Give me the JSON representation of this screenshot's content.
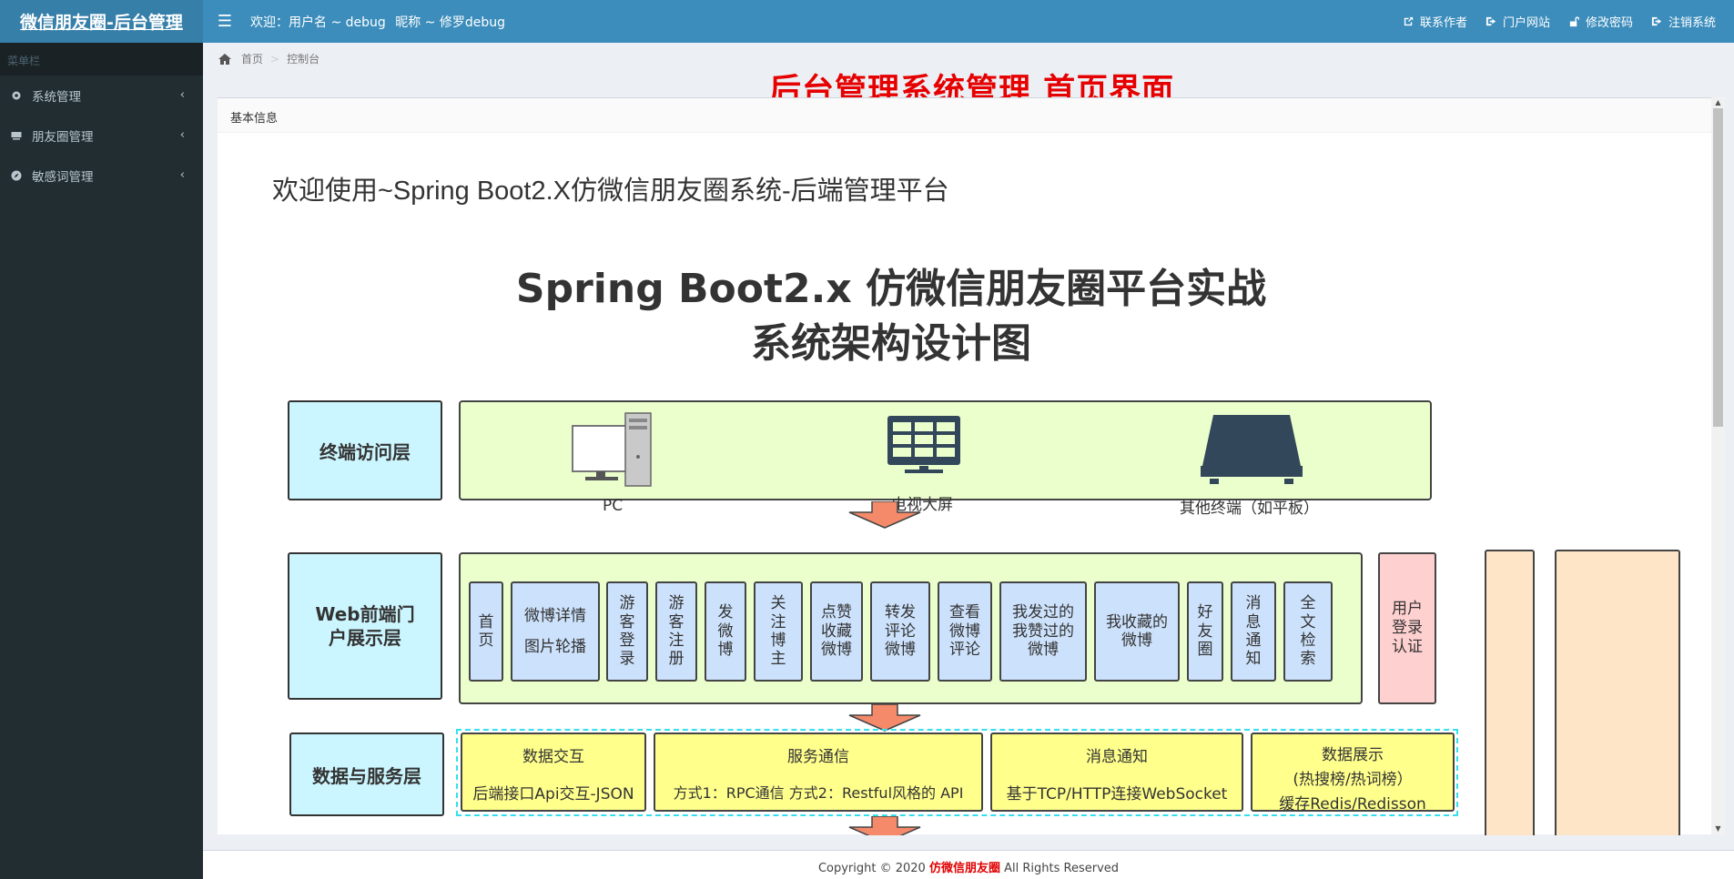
{
  "header": {
    "brand": "微信朋友圈-后台管理",
    "welcome_prefix": "欢迎：用户名 ~ debug",
    "welcome_nick": "昵称 ~ 修罗debug",
    "links": [
      {
        "label": "联系作者",
        "icon": "external-link-icon"
      },
      {
        "label": "门户网站",
        "icon": "sign-out-icon"
      },
      {
        "label": "修改密码",
        "icon": "unlock-icon"
      },
      {
        "label": "注销系统",
        "icon": "sign-out-icon"
      }
    ]
  },
  "sidebar": {
    "header": "菜单栏",
    "items": [
      {
        "label": "系统管理",
        "icon": "gear-icon"
      },
      {
        "label": "朋友圈管理",
        "icon": "keyboard-icon"
      },
      {
        "label": "敏感词管理",
        "icon": "compass-icon"
      }
    ]
  },
  "breadcrumb": {
    "home": "首页",
    "current": "控制台"
  },
  "overlay_title": "后台管理系统管理 首页界面",
  "box": {
    "header": "基本信息",
    "heading": "欢迎使用~Spring Boot2.X仿微信朋友圈系统-后端管理平台"
  },
  "diagram": {
    "title_line1": "Spring Boot2.x 仿微信朋友圈平台实战",
    "title_line2": "系统架构设计图",
    "layer_terminal": "终端访问层",
    "layer_web": "Web前端门户展示层",
    "layer_data": "数据与服务层",
    "terminals": [
      "PC",
      "电视大屏",
      "其他终端（如平板）"
    ],
    "web_modules": [
      "首页",
      "微博详情 图片轮播",
      "游客登录",
      "游客注册",
      "发微博",
      "关注博主",
      "点赞收藏微博",
      "转发评论微博",
      "查看微博评论",
      "我发过的我赞过的微博",
      "我收藏的微博",
      "好友圈",
      "消息通知",
      "全文检索"
    ],
    "auth": "用户登录认证",
    "services": [
      {
        "title": "数据交互",
        "desc": "后端接口Api交互-JSON"
      },
      {
        "title": "服务通信",
        "desc": "方式1：RPC通信 方式2：Restful风格的 API"
      },
      {
        "title": "消息通知",
        "desc": "基于TCP/HTTP连接WebSocket"
      },
      {
        "title": "数据展示",
        "desc1": "(热搜榜/热词榜）",
        "desc2": "缓存Redis/Redisson"
      }
    ]
  },
  "footer": {
    "prefix": "Copyright ©   2020",
    "brand": "仿微信朋友圈",
    "suffix": "All Rights Reserved"
  }
}
